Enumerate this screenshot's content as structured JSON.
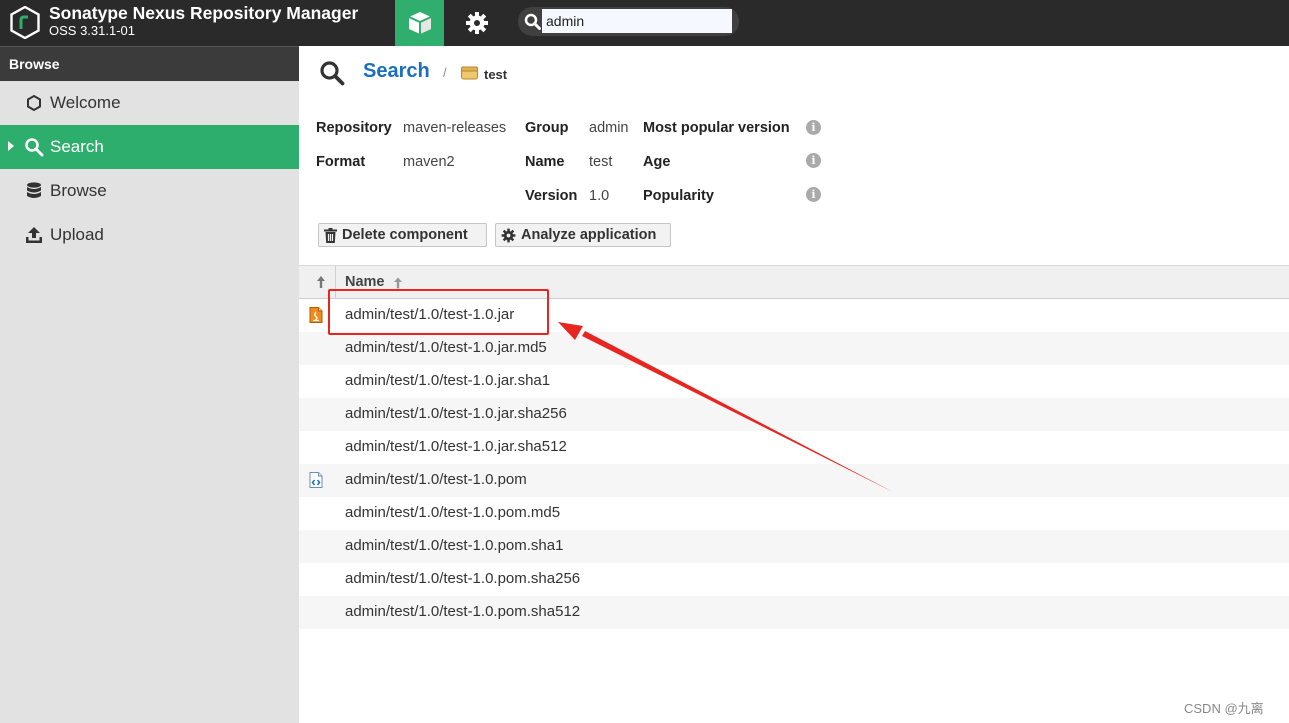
{
  "app": {
    "title": "Sonatype Nexus Repository Manager",
    "version": "OSS 3.31.1-01"
  },
  "topbar": {
    "search": {
      "value": "admin"
    }
  },
  "sidebar": {
    "header": "Browse",
    "items": [
      {
        "label": "Welcome",
        "icon": "hexagon-icon",
        "active": false
      },
      {
        "label": "Search",
        "icon": "search-icon",
        "active": true
      },
      {
        "label": "Browse",
        "icon": "database-icon",
        "active": false
      },
      {
        "label": "Upload",
        "icon": "upload-icon",
        "active": false
      }
    ]
  },
  "breadcrumb": {
    "title": "Search",
    "separator": "/",
    "item": "test"
  },
  "component": {
    "repository_label": "Repository",
    "repository": "maven-releases",
    "format_label": "Format",
    "format": "maven2",
    "group_label": "Group",
    "group": "admin",
    "name_label": "Name",
    "name": "test",
    "version_label": "Version",
    "version": "1.0",
    "popular_label": "Most popular version",
    "age_label": "Age",
    "popularity_label": "Popularity"
  },
  "actions": {
    "delete": "Delete component",
    "analyze": "Analyze application"
  },
  "grid": {
    "column": "Name",
    "rows": [
      {
        "name": "admin/test/1.0/test-1.0.jar",
        "icon": "jar-icon"
      },
      {
        "name": "admin/test/1.0/test-1.0.jar.md5",
        "icon": ""
      },
      {
        "name": "admin/test/1.0/test-1.0.jar.sha1",
        "icon": ""
      },
      {
        "name": "admin/test/1.0/test-1.0.jar.sha256",
        "icon": ""
      },
      {
        "name": "admin/test/1.0/test-1.0.jar.sha512",
        "icon": ""
      },
      {
        "name": "admin/test/1.0/test-1.0.pom",
        "icon": "pom-icon"
      },
      {
        "name": "admin/test/1.0/test-1.0.pom.md5",
        "icon": ""
      },
      {
        "name": "admin/test/1.0/test-1.0.pom.sha1",
        "icon": ""
      },
      {
        "name": "admin/test/1.0/test-1.0.pom.sha256",
        "icon": ""
      },
      {
        "name": "admin/test/1.0/test-1.0.pom.sha512",
        "icon": ""
      }
    ]
  },
  "watermark": "CSDN @九离",
  "colors": {
    "accent": "#2eae6d",
    "topbar": "#2a2a2a",
    "link": "#1b6fbf",
    "annotation": "#e8251f"
  }
}
